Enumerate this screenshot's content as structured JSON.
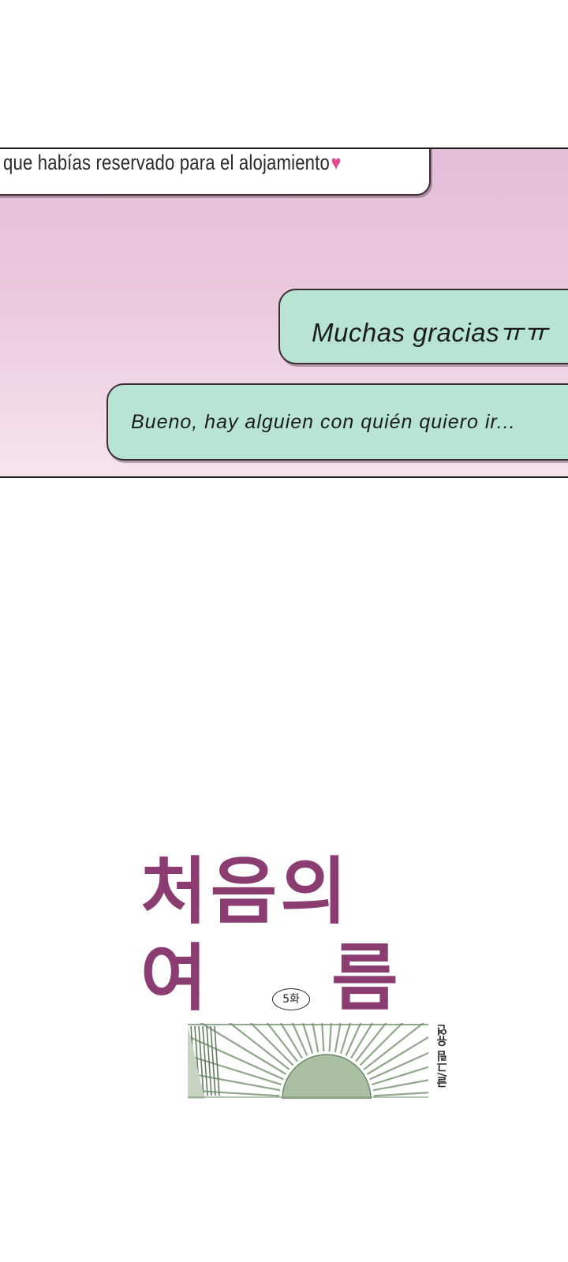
{
  "panel": {
    "message_received": "que habías reservado para el alojamiento",
    "heart_glyph": "♥",
    "message_sent_1": "Muchas graciasㅠㅠ",
    "message_sent_2": "Bueno, hay alguien con quién quiero ir..."
  },
  "title_card": {
    "title_line1": "처음의",
    "title_char_left": "여",
    "title_char_right": "름",
    "episode": "5화",
    "credit": "글/그림 유연"
  },
  "colors": {
    "title": "#8b3d72",
    "bubble_green": "#b8e5d3",
    "heart": "#e0488f",
    "sun_green": "#a9c0a3"
  }
}
